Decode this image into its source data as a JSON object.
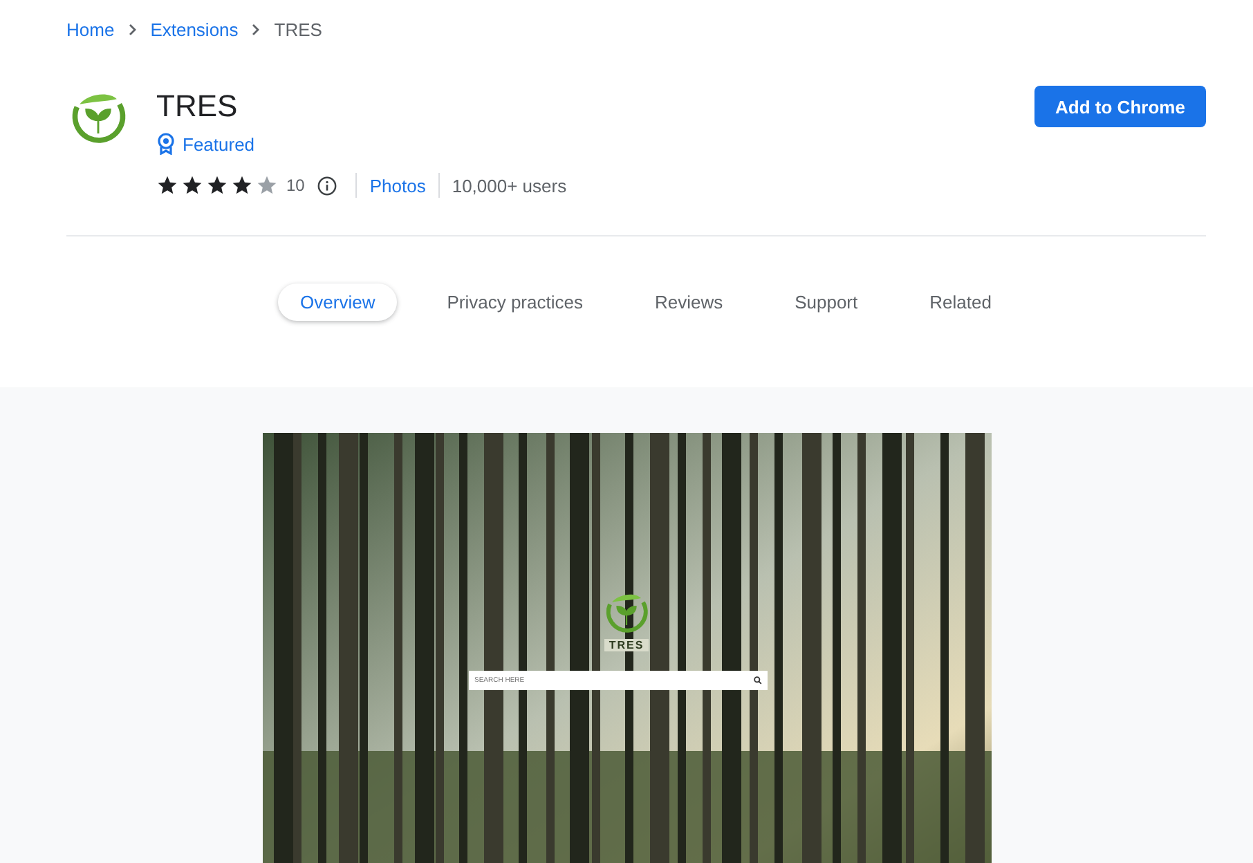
{
  "breadcrumb": [
    {
      "label": "Home",
      "link": true
    },
    {
      "label": "Extensions",
      "link": true
    },
    {
      "label": "TRES",
      "link": false
    }
  ],
  "extension": {
    "name": "TRES",
    "badge": "Featured",
    "stars": 4,
    "rating_count": "10",
    "category": "Photos",
    "users": "10,000+ users"
  },
  "add_button": "Add to Chrome",
  "tabs": [
    {
      "label": "Overview",
      "selected": true
    },
    {
      "label": "Privacy practices",
      "selected": false
    },
    {
      "label": "Reviews",
      "selected": false
    },
    {
      "label": "Support",
      "selected": false
    },
    {
      "label": "Related",
      "selected": false
    }
  ],
  "preview": {
    "app_title": "TRES",
    "search": {
      "placeholder": "SEARCH HERE"
    }
  }
}
